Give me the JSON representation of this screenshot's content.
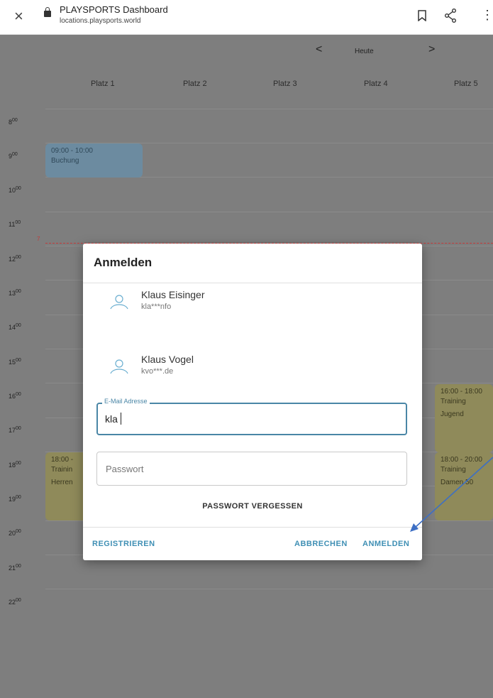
{
  "browser": {
    "close_glyph": "×",
    "title": "PLAYSPORTS Dashboard",
    "url": "locations.playsports.world",
    "more_glyph": "⋮"
  },
  "calendar": {
    "prev_glyph": "<",
    "today_label": "Heute",
    "next_glyph": ">",
    "courts": [
      "Platz 1",
      "Platz 2",
      "Platz 3",
      "Platz 4",
      "Platz 5"
    ],
    "hours": [
      "8",
      "9",
      "10",
      "11",
      "12",
      "13",
      "14",
      "15",
      "16",
      "17",
      "18",
      "19",
      "20",
      "21",
      "22"
    ],
    "hour_suffix": "00",
    "now_marker": "7",
    "events": [
      {
        "time": "09:00 - 10:00",
        "line2": "Buchung",
        "line3": ""
      },
      {
        "time": "16:00 - 18:00",
        "line2": "Training",
        "line3": "Jugend"
      },
      {
        "time": "18:00 -",
        "line2": "Trainin",
        "line3": "Herren"
      },
      {
        "time": "18:00 - 20:00",
        "line2": "Training",
        "line3": "Damen 50"
      }
    ]
  },
  "dialog": {
    "title": "Anmelden",
    "accounts": [
      {
        "name": "Klaus Eisinger",
        "email": "kla***nfo"
      },
      {
        "name": "Klaus Vogel",
        "email": "kvo***.de"
      }
    ],
    "email_label": "E-Mail Adresse",
    "email_value": "kla",
    "password_placeholder": "Passwort",
    "forgot_label": "PASSWORT VERGESSEN",
    "register_label": "REGISTRIEREN",
    "cancel_label": "ABBRECHEN",
    "login_label": "ANMELDEN"
  },
  "colors": {
    "accent": "#3f8fb4",
    "overlay": "#7e7e7e",
    "event_blue": "#6c8ba0",
    "event_yellow": "#8f8a5a",
    "annotation_arrow": "#3d6fc4"
  }
}
